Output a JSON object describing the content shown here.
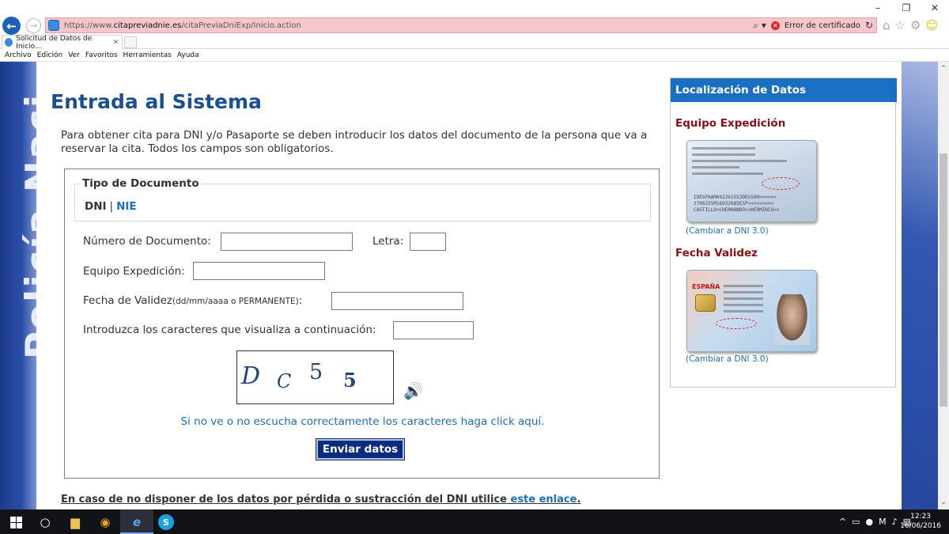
{
  "browser": {
    "window_controls": {
      "minimize": "–",
      "restore": "❐",
      "close": "✕"
    },
    "url_prefix": "https://www.",
    "url_domain": "citapreviadnie.es",
    "url_path": "/citaPreviaDniExp/Inicio.action",
    "cert_error": "Error de certificado",
    "tab_title": "Solicitud de Datos de Inicio...",
    "tab_close": "✕",
    "menu": [
      "Archivo",
      "Edición",
      "Ver",
      "Favoritos",
      "Herramientas",
      "Ayuda"
    ],
    "icons": [
      "home-icon",
      "star-icon",
      "gear-icon",
      "smiley-icon"
    ]
  },
  "sidebar_deco_text": "Policía Naci",
  "page": {
    "title": "Entrada al Sistema",
    "intro": "Para obtener cita para DNI y/o Pasaporte se deben introducir los datos del documento de la persona que va a reservar la cita. Todos los campos son obligatorios.",
    "doc_type": {
      "legend": "Tipo de Documento",
      "dni": "DNI",
      "separator": "|",
      "nie": "NIE"
    },
    "fields": {
      "doc_number_label": "Número de Documento:",
      "letter_label": "Letra:",
      "equipo_label": "Equipo Expedición:",
      "fecha_label": "Fecha de Validez",
      "fecha_hint": "(dd/mm/aaaa o PERMANENTE)",
      "fecha_colon": ":",
      "captcha_label": "Introduzca los caracteres que visualiza a continuación:",
      "doc_number_value": "",
      "letter_value": "",
      "equipo_value": "",
      "fecha_value": "",
      "captcha_value": ""
    },
    "captcha_chars": [
      "D",
      "C",
      "5",
      "5"
    ],
    "help_link": "Si no ve o no escucha correctamente los caracteres haga click aquí.",
    "submit": "Enviar datos",
    "bottom_note": "En caso de no disponer de los datos por pérdida o sustracción del DNI utilice",
    "bottom_link": "este enlace",
    "bottom_end": "."
  },
  "sidebar": {
    "header": "Localización de Datos",
    "section1": "Equipo Expedición",
    "link1": "(Cambiar a DNI 3.0)",
    "section2": "Fecha Validez",
    "link2": "(Cambiar a DNI 3.0)",
    "card_country": "ESPAÑA"
  },
  "taskbar": {
    "time": "12:23",
    "date": "16/06/2016"
  },
  "colors": {
    "title_blue": "#1a4f93",
    "link_blue": "#1b6fb8",
    "section_red": "#8b1012",
    "button_navy": "#0a2c80",
    "cert_bar_pink": "#f6c6cc"
  }
}
